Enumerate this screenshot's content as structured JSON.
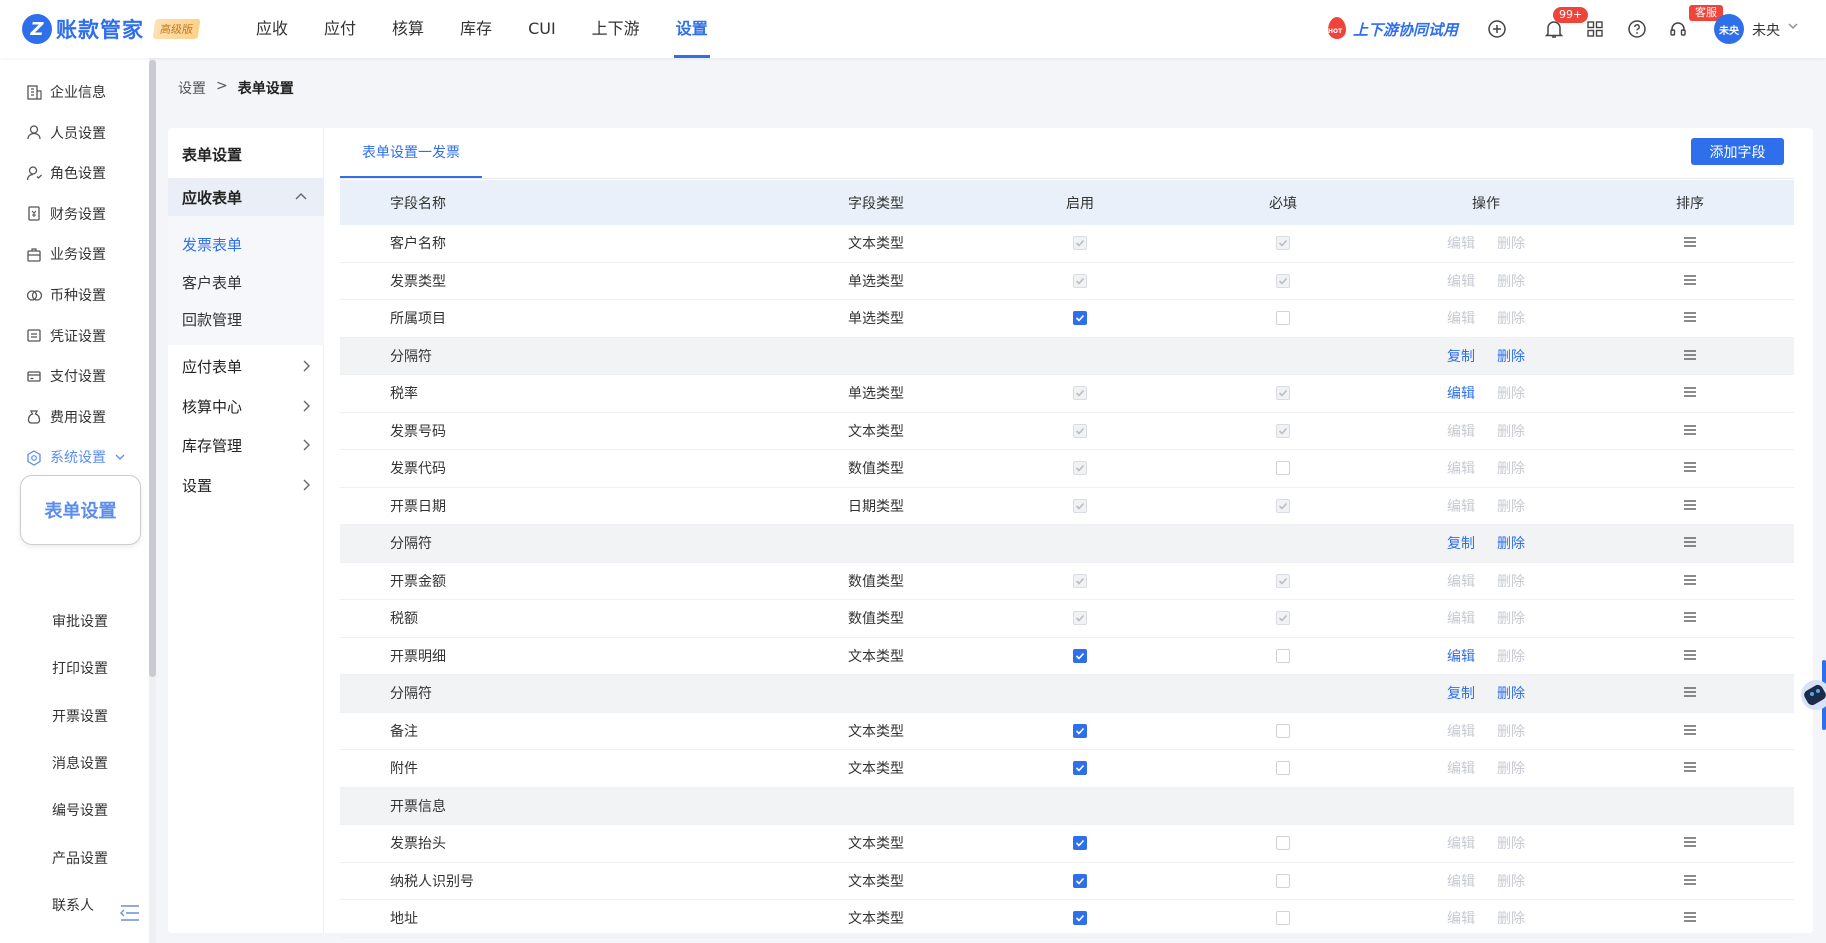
{
  "app": {
    "logo_mark": "Z",
    "name": "账款管家",
    "edition": "高级版"
  },
  "nav": [
    {
      "label": "应收"
    },
    {
      "label": "应付"
    },
    {
      "label": "核算"
    },
    {
      "label": "库存"
    },
    {
      "label": "CUI"
    },
    {
      "label": "上下游"
    },
    {
      "label": "设置",
      "active": true
    }
  ],
  "header": {
    "trial_label": "上下游协同试用",
    "hot_label": "HOT",
    "notif_badge": "99+",
    "service_badge": "客服",
    "avatar_text": "未央",
    "user_name": "未央"
  },
  "sidebar": {
    "items": [
      {
        "label": "企业信息",
        "icon": "building-icon"
      },
      {
        "label": "人员设置",
        "icon": "person-icon"
      },
      {
        "label": "角色设置",
        "icon": "role-icon"
      },
      {
        "label": "财务设置",
        "icon": "finance-icon"
      },
      {
        "label": "业务设置",
        "icon": "business-icon"
      },
      {
        "label": "币种设置",
        "icon": "currency-icon"
      },
      {
        "label": "凭证设置",
        "icon": "voucher-icon"
      },
      {
        "label": "支付设置",
        "icon": "payment-icon"
      },
      {
        "label": "费用设置",
        "icon": "expense-icon"
      },
      {
        "label": "系统设置",
        "icon": "system-icon"
      }
    ],
    "highlight": "表单设置",
    "subitems": [
      "审批设置",
      "打印设置",
      "开票设置",
      "消息设置",
      "编号设置",
      "产品设置",
      "联系人"
    ]
  },
  "breadcrumb": {
    "root": "设置",
    "separator": ">",
    "current": "表单设置"
  },
  "subnav": {
    "title": "表单设置",
    "open_group": "应收表单",
    "leaves": [
      "发票表单",
      "客户表单",
      "回款管理"
    ],
    "groups": [
      "应付表单",
      "核算中心",
      "库存管理",
      "设置"
    ]
  },
  "tab_label": "表单设置一发票",
  "add_button": "添加字段",
  "table": {
    "headers": {
      "name": "字段名称",
      "type": "字段类型",
      "enabled": "启用",
      "required": "必填",
      "ops": "操作",
      "sort": "排序"
    },
    "op_labels": {
      "edit": "编辑",
      "delete": "删除",
      "copy": "复制"
    },
    "rows": [
      {
        "name": "客户名称",
        "type": "文本类型",
        "en": "dis-on",
        "req": "dis-on",
        "kind": "field",
        "edit": false
      },
      {
        "name": "发票类型",
        "type": "单选类型",
        "en": "dis-on",
        "req": "dis-on",
        "kind": "field",
        "edit": false
      },
      {
        "name": "所属项目",
        "type": "单选类型",
        "en": "on",
        "req": "off",
        "kind": "field",
        "edit": false
      },
      {
        "name": "分隔符",
        "type": "",
        "kind": "sep"
      },
      {
        "name": "税率",
        "type": "单选类型",
        "en": "dis-on",
        "req": "dis-on",
        "kind": "field",
        "edit": true
      },
      {
        "name": "发票号码",
        "type": "文本类型",
        "en": "dis-on",
        "req": "dis-on",
        "kind": "field",
        "edit": false
      },
      {
        "name": "发票代码",
        "type": "数值类型",
        "en": "dis-on",
        "req": "off",
        "kind": "field",
        "edit": false
      },
      {
        "name": "开票日期",
        "type": "日期类型",
        "en": "dis-on",
        "req": "dis-on",
        "kind": "field",
        "edit": false
      },
      {
        "name": "分隔符",
        "type": "",
        "kind": "sep"
      },
      {
        "name": "开票金额",
        "type": "数值类型",
        "en": "dis-on",
        "req": "dis-on",
        "kind": "field",
        "edit": false
      },
      {
        "name": "税额",
        "type": "数值类型",
        "en": "dis-on",
        "req": "dis-on",
        "kind": "field",
        "edit": false
      },
      {
        "name": "开票明细",
        "type": "文本类型",
        "en": "on",
        "req": "off",
        "kind": "field",
        "edit": true
      },
      {
        "name": "分隔符",
        "type": "",
        "kind": "sep"
      },
      {
        "name": "备注",
        "type": "文本类型",
        "en": "on",
        "req": "off",
        "kind": "field",
        "edit": false
      },
      {
        "name": "附件",
        "type": "文本类型",
        "en": "on",
        "req": "off",
        "kind": "field",
        "edit": false
      },
      {
        "name": "开票信息",
        "type": "",
        "kind": "group"
      },
      {
        "name": "发票抬头",
        "type": "文本类型",
        "en": "on",
        "req": "off",
        "kind": "field",
        "edit": false
      },
      {
        "name": "纳税人识别号",
        "type": "文本类型",
        "en": "on",
        "req": "off",
        "kind": "field",
        "edit": false
      },
      {
        "name": "地址",
        "type": "文本类型",
        "en": "on",
        "req": "off",
        "kind": "field",
        "edit": false
      }
    ]
  },
  "colors": {
    "accent": "#2f6fec",
    "disabled": "#c6cad1",
    "hot": "#f0433a"
  }
}
